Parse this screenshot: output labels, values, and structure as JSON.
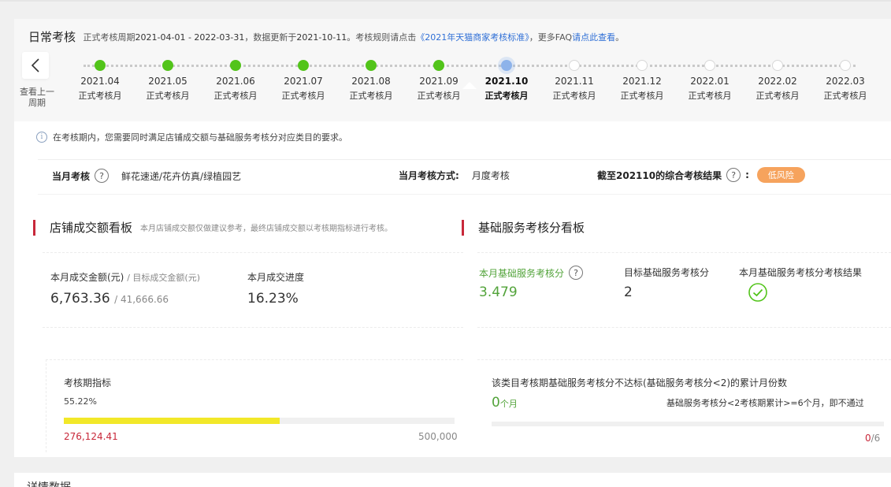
{
  "header": {
    "title": "日常考核",
    "prefix": "正式考核周期",
    "cycle": "2021-04-01 - 2022-03-31",
    "updated_text": "，数据更新于",
    "updated_date": "2021-10-11",
    "rules_text": "。考核规则请点击",
    "rules_link": "《2021年天猫商家考核标准》",
    "faq_text": "，更多FAQ",
    "faq_link": "请点此查看",
    "end": "。"
  },
  "timeline": {
    "prev_label": "查看上一周期",
    "items": [
      {
        "month": "2021.04",
        "type": "正式考核月",
        "state": "done"
      },
      {
        "month": "2021.05",
        "type": "正式考核月",
        "state": "done"
      },
      {
        "month": "2021.06",
        "type": "正式考核月",
        "state": "done"
      },
      {
        "month": "2021.07",
        "type": "正式考核月",
        "state": "done"
      },
      {
        "month": "2021.08",
        "type": "正式考核月",
        "state": "done"
      },
      {
        "month": "2021.09",
        "type": "正式考核月",
        "state": "done"
      },
      {
        "month": "2021.10",
        "type": "正式考核月",
        "state": "current"
      },
      {
        "month": "2021.11",
        "type": "正式考核月",
        "state": "future"
      },
      {
        "month": "2021.12",
        "type": "正式考核月",
        "state": "future"
      },
      {
        "month": "2022.01",
        "type": "正式考核月",
        "state": "future"
      },
      {
        "month": "2022.02",
        "type": "正式考核月",
        "state": "future"
      },
      {
        "month": "2022.03",
        "type": "正式考核月",
        "state": "future"
      }
    ]
  },
  "notice": "在考核期内，您需要同时满足店铺成交额与基础服务考核分对应类目的要求。",
  "summary": {
    "month_label": "当月考核",
    "month_value": "鲜花速递/花卉仿真/绿植园艺",
    "method_label": "当月考核方式:",
    "method_value": "月度考核",
    "result_label": "截至202110的综合考核结果",
    "result_value": "低风险"
  },
  "sales": {
    "title": "店铺成交额看板",
    "subtitle": "本月店铺成交额仅做建议参考，最终店铺成交额以考核期指标进行考核。",
    "amount_label": "本月成交金额(元)",
    "target_label": "/ 目标成交金额(元)",
    "amount": "6,763.36",
    "target": "41,666.66",
    "progress_label": "本月成交进度",
    "progress": "16.23%",
    "period_label": "考核期指标",
    "period_percent": "55.22%",
    "period_fraction": 0.5522,
    "period_current": "276,124.41",
    "period_target": "500,000"
  },
  "service": {
    "title": "基础服务考核分看板",
    "score_label": "本月基础服务考核分",
    "score": "3.479",
    "target_label": "目标基础服务考核分",
    "target": "2",
    "result_label": "本月基础服务考核分考核结果",
    "fail_label": "该类目考核期基础服务考核分不达标(基础服务考核分<2)的累计月份数",
    "fail_count": "0",
    "fail_unit": "个月",
    "rule_text": "基础服务考核分<2考核期累计>=6个月，即不通过",
    "fail_fraction_num": "0",
    "fail_fraction_den": "/6"
  },
  "bottom": {
    "title": "详情数据"
  },
  "colors": {
    "green": "#52c41a",
    "accent_red": "#c8283a",
    "badge_orange": "#f6a35d",
    "progress_yellow": "#f2e829",
    "link_blue": "#2f6fd6"
  }
}
